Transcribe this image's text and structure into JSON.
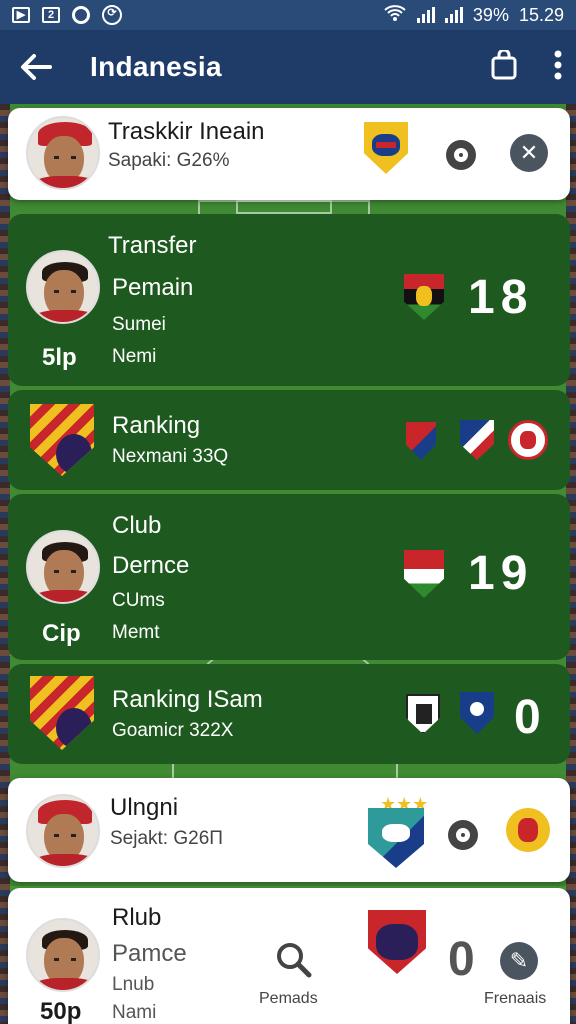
{
  "status_bar": {
    "battery": "39%",
    "time": "15.29"
  },
  "app_bar": {
    "title": "Indanesia",
    "back_icon": "arrow-left-icon",
    "bag_icon": "bag-icon",
    "menu_icon": "more-vert-icon"
  },
  "cards": [
    {
      "name": "Traskkir Ineain",
      "sub": "Sapaki: G26%"
    },
    {
      "line1": "Transfer",
      "line2": "Pemain",
      "line3": "Sumei",
      "line4": "Nemi",
      "badge": "5lp",
      "number": "18"
    },
    {
      "name": "Ranking",
      "sub": "Nexmani 33Q"
    },
    {
      "line1": "Club",
      "line2": "Dernce",
      "line3": "CUms",
      "line4": "Memt",
      "badge": "Cip",
      "number": "19"
    },
    {
      "name": "Ranking ISam",
      "sub": "Goamicr 322X",
      "number": "0"
    },
    {
      "name": "Ulngni",
      "sub": "Sejakt: G26Π"
    },
    {
      "line1": "Rlub",
      "line2": "Pamce",
      "line3": "Lnub",
      "line4": "Nami",
      "badge": "50p",
      "number": "0",
      "search_label": "Pemads",
      "right_label": "Frenaais"
    }
  ]
}
